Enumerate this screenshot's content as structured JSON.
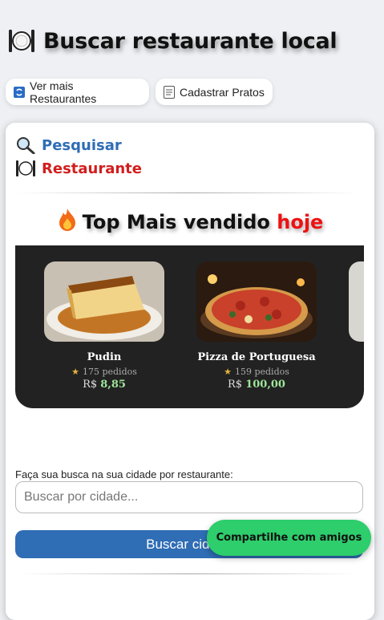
{
  "header": {
    "title": "Buscar restaurante local"
  },
  "top_buttons": {
    "more_restaurants": "Ver mais Restaurantes",
    "register_dishes": "Cadastrar Pratos"
  },
  "nav": {
    "search": "Pesquisar",
    "restaurant": "Restaurante"
  },
  "top_sold": {
    "title_main": "Top Mais vendido",
    "title_highlight": "hoje"
  },
  "items": [
    {
      "name": "Pudin",
      "orders": "175 pedidos",
      "currency": "R$",
      "price": "8,85"
    },
    {
      "name": "Pizza de Portuguesa",
      "orders": "159 pedidos",
      "currency": "R$",
      "price": "100,00"
    }
  ],
  "search": {
    "label": "Faça sua busca na sua cidade por restaurante:",
    "placeholder": "Buscar por cidade...",
    "button": "Buscar cidade"
  },
  "share": {
    "label": "Compartilhe com amigos"
  },
  "colors": {
    "search_blue": "#2f6db5",
    "restaurant_red": "#d21e1e",
    "highlight_red": "#e11111",
    "share_green": "#2dce6b",
    "price_green": "#9fe79a"
  }
}
